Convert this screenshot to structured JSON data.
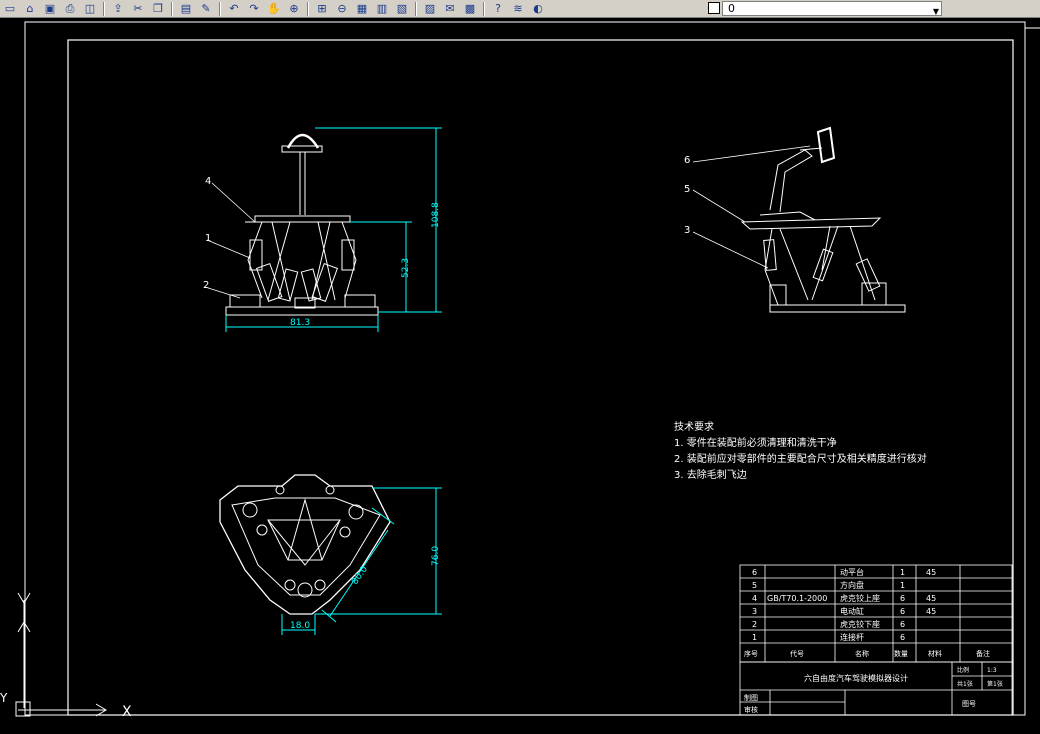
{
  "toolbar": {
    "layer_value": "0",
    "buttons": [
      "new-icon",
      "open-icon",
      "save-icon",
      "print-icon",
      "plot-preview-icon",
      "publish-icon",
      "cut-icon",
      "copy-icon",
      "paste-icon",
      "match-properties-icon",
      "undo-icon",
      "redo-icon",
      "pan-icon",
      "zoom-realtime-icon",
      "zoom-window-icon",
      "zoom-previous-icon",
      "properties-icon",
      "design-center-icon",
      "tool-palettes-icon",
      "sheet-set-icon",
      "markup-icon",
      "calculator-icon",
      "help-icon",
      "layer-manager-icon",
      "layer-state-icons"
    ]
  },
  "drawing": {
    "front_view": {
      "width_dim": "81.3",
      "height_dim_total": "108.8",
      "height_dim_lower": "52.3",
      "balloons": [
        "4",
        "1",
        "2"
      ]
    },
    "iso_view": {
      "balloons": [
        "6",
        "5",
        "3"
      ]
    },
    "top_view": {
      "dim_height": "76.0",
      "dim_diag": "80.0",
      "dim_width": "18.0"
    },
    "tech_requirements": {
      "title": "技术要求",
      "items": [
        "1. 零件在装配前必须清理和清洗干净",
        "2. 装配前应对零部件的主要配合尺寸及相关精度进行核对",
        "3. 去除毛刺飞边"
      ]
    },
    "bom": {
      "rows": [
        {
          "no": "6",
          "code": "",
          "name": "动平台",
          "qty": "1",
          "material": "45"
        },
        {
          "no": "5",
          "code": "",
          "name": "方向盘",
          "qty": "1",
          "material": ""
        },
        {
          "no": "4",
          "code": "GB/T70.1-2000",
          "name": "虎克铰上座",
          "qty": "6",
          "material": "45"
        },
        {
          "no": "3",
          "code": "",
          "name": "电动缸",
          "qty": "6",
          "material": "45"
        },
        {
          "no": "2",
          "code": "",
          "name": "虎克铰下座",
          "qty": "6",
          "material": ""
        },
        {
          "no": "1",
          "code": "",
          "name": "连接杆",
          "qty": "6",
          "material": ""
        }
      ],
      "header": {
        "no": "序号",
        "code": "代号",
        "name": "名称",
        "qty": "数量",
        "material": "材料",
        "remark": "备注"
      }
    },
    "title_block": {
      "title": "六自由度汽车驾驶模拟器设计",
      "scale_label": "比例",
      "scale_value": "1:3",
      "sheet_label": "共1张",
      "sheet_value": "第1张",
      "drawn_label": "制图",
      "checked_label": "审核",
      "drawing_no_label": "图号"
    },
    "ucs": {
      "x_label": "X",
      "y_label": "Y"
    }
  }
}
